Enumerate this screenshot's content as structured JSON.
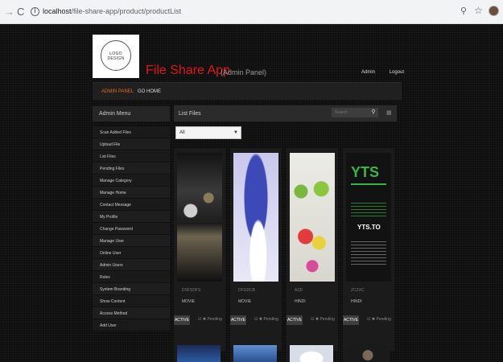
{
  "browser": {
    "url_host": "localhost",
    "url_path": "/file-share-app/product/productList"
  },
  "header": {
    "logo_text_line1": "LOGO",
    "logo_text_line2": "DESIGN",
    "app_title": "File Share App",
    "app_subtitle": "(Admin Panel)",
    "user_link": "Admin",
    "logout_link": "Logout"
  },
  "topnav": {
    "active_label": "ADMIN PANEL",
    "home_label": "GO HOME",
    "active_color": "#e06a1b"
  },
  "sidebar": {
    "title": "Admin Menu",
    "items": [
      "Scan Added Files",
      "Upload File",
      "List Files",
      "Pending Files",
      "Manage Category",
      "Manage Home",
      "Contact Message",
      "My Profile",
      "Change Password",
      "Manage User",
      "Online User",
      "Admin Users",
      "Roles",
      "System Branding",
      "Show Content",
      "Access Method",
      "Add User"
    ]
  },
  "main": {
    "title": "List Files",
    "search_placeholder": "Search",
    "filter_selected": "All"
  },
  "cards": [
    {
      "code": "DSFSDFS",
      "category": "MOVIE",
      "status": "ACTIVE",
      "pending": "☑ ✖ Pending"
    },
    {
      "code": "DFGDCB",
      "category": "MOVIE",
      "status": "ACTIVE",
      "pending": "☑ ✖ Pending"
    },
    {
      "code": "ASD",
      "category": "HINDI",
      "status": "ACTIVE",
      "pending": "☑ ✖ Pending"
    },
    {
      "code": "ZCZXC",
      "category": "HINDI",
      "status": "ACTIVE",
      "pending": "☑ ✖ Pending"
    }
  ],
  "yts_thumb": {
    "logo": "YTS",
    "site": "YTS.TO"
  },
  "colors": {
    "brand_red": "#e0151a",
    "page_bg": "#0e0e0e"
  }
}
